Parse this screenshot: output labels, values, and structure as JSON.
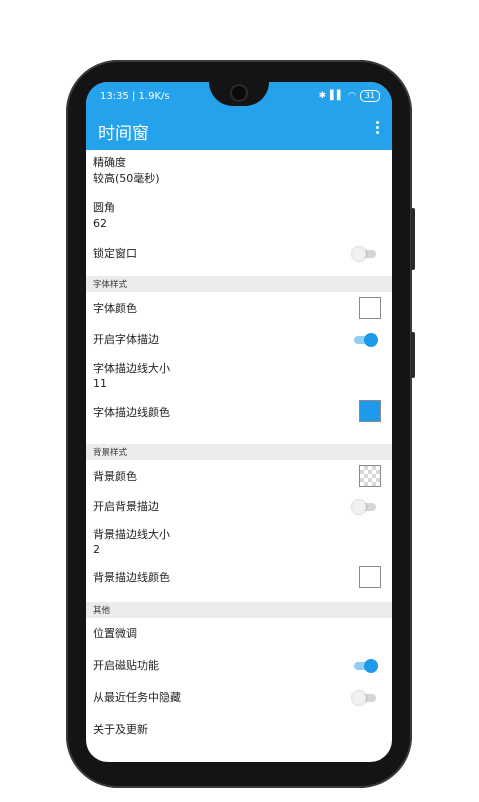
{
  "status": {
    "time_speed": "13:35 | 1.9K/s",
    "signal_text": "✱ ⁴ᴳ.ıll .ıll",
    "battery": "31"
  },
  "app": {
    "title": "时间窗",
    "menu_icon": "more-vert-icon"
  },
  "settings": {
    "precision_title": "精确度",
    "precision_value": "较高(50毫秒)",
    "corner_title": "圆角",
    "corner_value": "62",
    "lock_window": "锁定窗口",
    "section_font": "字体样式",
    "font_color": "字体颜色",
    "font_stroke_on": "开启字体描边",
    "font_stroke_size_title": "字体描边线大小",
    "font_stroke_size_value": "11",
    "font_stroke_color": "字体描边线颜色",
    "section_bg": "背景样式",
    "bg_color": "背景颜色",
    "bg_stroke_on": "开启背景描边",
    "bg_stroke_size_title": "背景描边线大小",
    "bg_stroke_size_value": "2",
    "bg_stroke_color": "背景描边线颜色",
    "section_other": "其他",
    "position_tune": "位置微调",
    "magnet": "开启磁贴功能",
    "hide_recent": "从最近任务中隐藏",
    "about": "关于及更新"
  },
  "toggles": {
    "lock_window": false,
    "font_stroke": true,
    "bg_stroke": false,
    "magnet": true,
    "hide_recent": false
  },
  "colors": {
    "accent": "#24a2eb",
    "font_color_swatch": "#ffffff",
    "font_stroke_color_swatch": "#1f9aeb",
    "bg_stroke_color_swatch": "#ffffff"
  }
}
